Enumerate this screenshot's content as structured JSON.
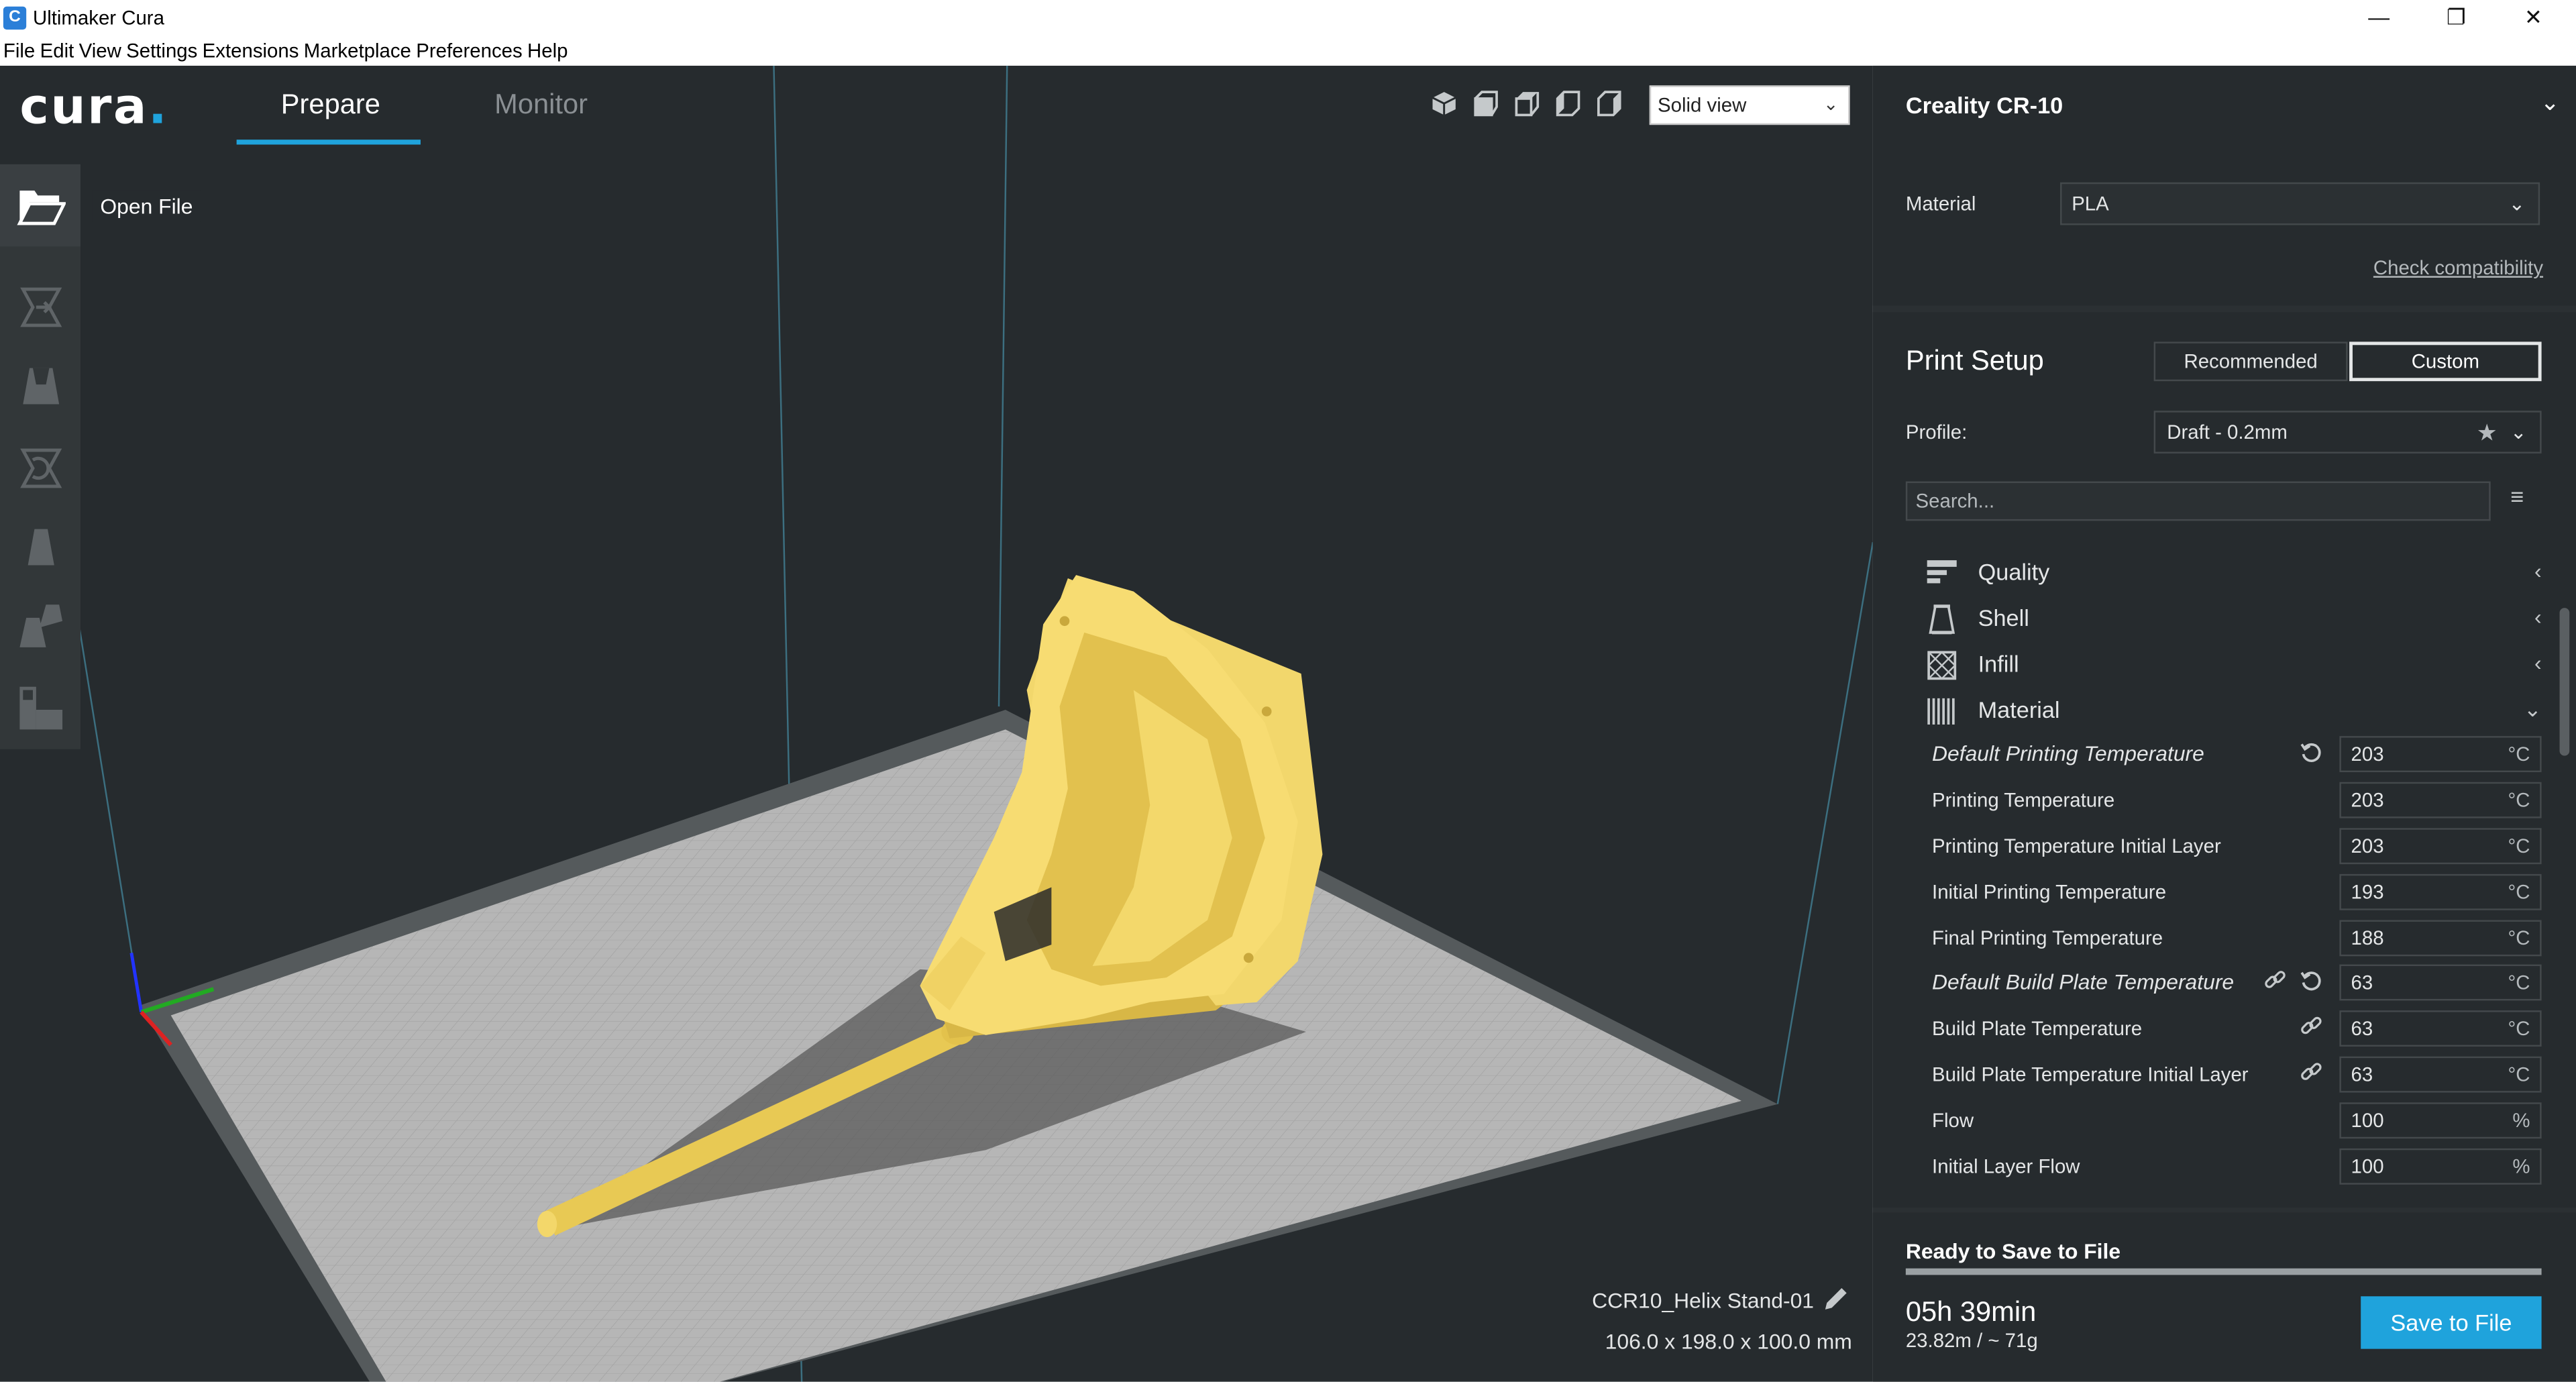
{
  "window": {
    "app_icon_letter": "C",
    "title": "Ultimaker Cura",
    "controls": {
      "minimize": "—",
      "maximize": "❐",
      "close": "✕"
    }
  },
  "menu": [
    "File",
    "Edit",
    "View",
    "Settings",
    "Extensions",
    "Marketplace",
    "Preferences",
    "Help"
  ],
  "header": {
    "logo_text": "cura",
    "logo_dot": ".",
    "tabs": [
      {
        "label": "Prepare",
        "active": true
      },
      {
        "label": "Monitor",
        "active": false
      }
    ],
    "view_mode": "Solid view"
  },
  "toolbar": {
    "tooltip": "Open File",
    "tools": [
      "open-file",
      "move",
      "scale",
      "rotate",
      "mirror",
      "per-model-settings",
      "support-blocker"
    ]
  },
  "object": {
    "name": "CCR10_Helix Stand-01",
    "dimensions": "106.0 x 198.0 x 100.0 mm"
  },
  "printer": {
    "name": "Creality CR-10",
    "material_label": "Material",
    "material": "PLA",
    "check_compat": "Check compatibility"
  },
  "print_setup": {
    "title": "Print Setup",
    "modes": [
      "Recommended",
      "Custom"
    ],
    "active_mode": "Custom",
    "profile_label": "Profile:",
    "profile": "Draft - 0.2mm",
    "search_placeholder": "Search..."
  },
  "categories": [
    {
      "label": "Quality",
      "icon": "quality-icon",
      "expanded": false
    },
    {
      "label": "Shell",
      "icon": "shell-icon",
      "expanded": false
    },
    {
      "label": "Infill",
      "icon": "infill-icon",
      "expanded": false
    },
    {
      "label": "Material",
      "icon": "material-icon",
      "expanded": true
    }
  ],
  "settings": [
    {
      "label": "Default Printing Temperature",
      "value": "203",
      "unit": "°C",
      "italic": true,
      "reset": true,
      "link": false
    },
    {
      "label": "Printing Temperature",
      "value": "203",
      "unit": "°C",
      "italic": false,
      "reset": false,
      "link": false
    },
    {
      "label": "Printing Temperature Initial Layer",
      "value": "203",
      "unit": "°C",
      "italic": false,
      "reset": false,
      "link": false
    },
    {
      "label": "Initial Printing Temperature",
      "value": "193",
      "unit": "°C",
      "italic": false,
      "reset": false,
      "link": false
    },
    {
      "label": "Final Printing Temperature",
      "value": "188",
      "unit": "°C",
      "italic": false,
      "reset": false,
      "link": false
    },
    {
      "label": "Default Build Plate Temperature",
      "value": "63",
      "unit": "°C",
      "italic": true,
      "reset": true,
      "link": true
    },
    {
      "label": "Build Plate Temperature",
      "value": "63",
      "unit": "°C",
      "italic": false,
      "reset": false,
      "link": true
    },
    {
      "label": "Build Plate Temperature Initial Layer",
      "value": "63",
      "unit": "°C",
      "italic": false,
      "reset": false,
      "link": true
    },
    {
      "label": "Flow",
      "value": "100",
      "unit": "%",
      "italic": false,
      "reset": false,
      "link": false
    },
    {
      "label": "Initial Layer Flow",
      "value": "100",
      "unit": "%",
      "italic": false,
      "reset": false,
      "link": false
    }
  ],
  "save": {
    "status": "Ready to Save to File",
    "progress": 1.0,
    "time": "05h 39min",
    "usage": "23.82m / ~ 71g",
    "button": "Save to File"
  },
  "colors": {
    "accent": "#1fa3dc",
    "model": "#f5d96b",
    "background": "#262b2e",
    "panel": "#2b3033"
  }
}
